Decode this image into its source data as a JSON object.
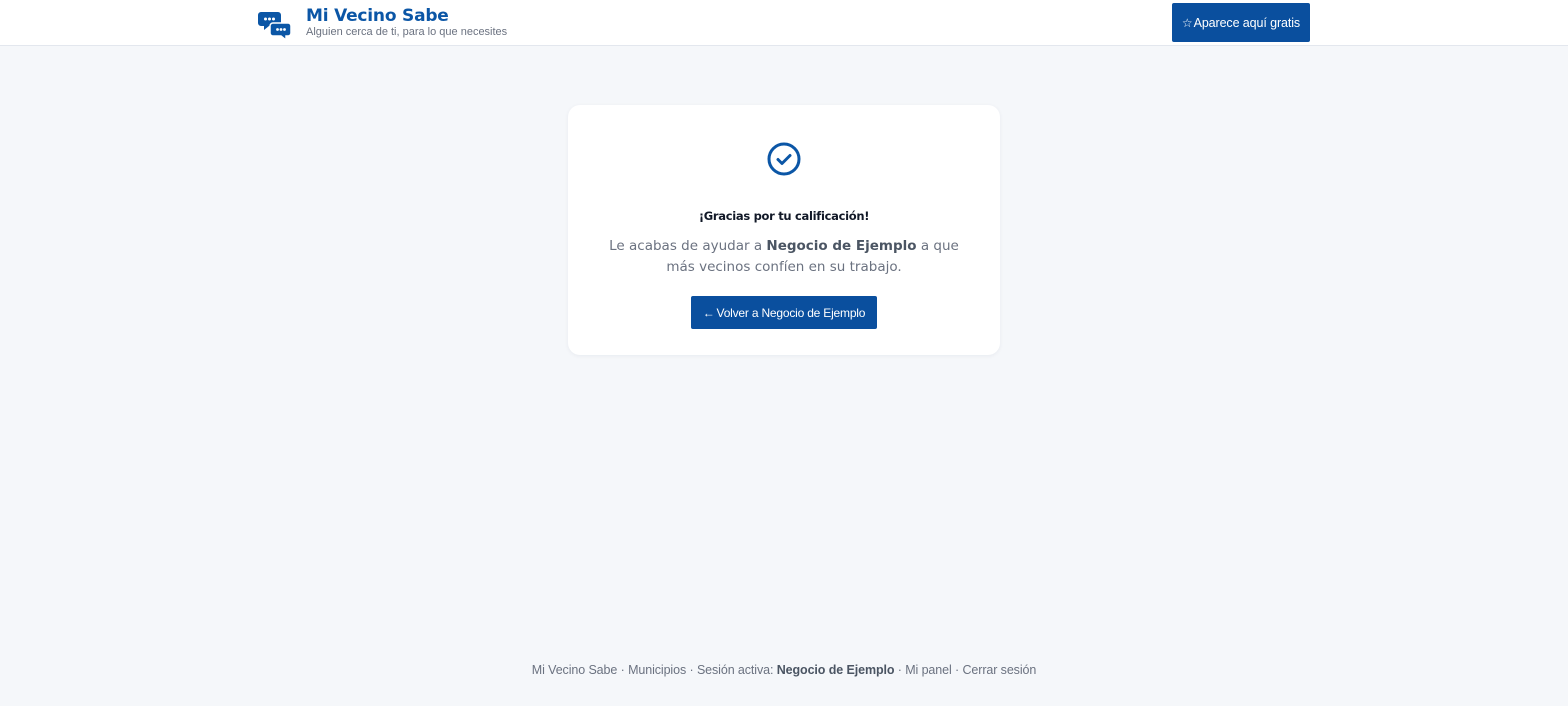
{
  "header": {
    "brand_title": "Mi Vecino Sabe",
    "brand_subtitle": "Alguien cerca de ti, para lo que necesites",
    "brand_icon": "chat-bubbles-icon",
    "cta_icon": "star-outline-icon",
    "cta_label": "Aparece aquí gratis"
  },
  "card": {
    "icon": "check-circle-icon",
    "title": "¡Gracias por tu calificación!",
    "message_prefix": "Le acabas de ayudar a ",
    "business_name": "Negocio de Ejemplo",
    "message_suffix": " a que más vecinos confíen en su trabajo.",
    "back_icon": "arrow-left-icon",
    "back_label": "Volver a Negocio de Ejemplo"
  },
  "footer": {
    "home_link": "Mi Vecino Sabe",
    "municipios_link": "Municipios",
    "session_label": "Sesión activa:",
    "session_user": "Negocio de Ejemplo",
    "panel_link": "Mi panel",
    "logout_link": "Cerrar sesión",
    "separator": " · "
  },
  "colors": {
    "brand": "#0b56a6",
    "button": "#0a4f9e",
    "background": "#f5f7fa",
    "card": "#ffffff",
    "muted_text": "#6b7280"
  }
}
